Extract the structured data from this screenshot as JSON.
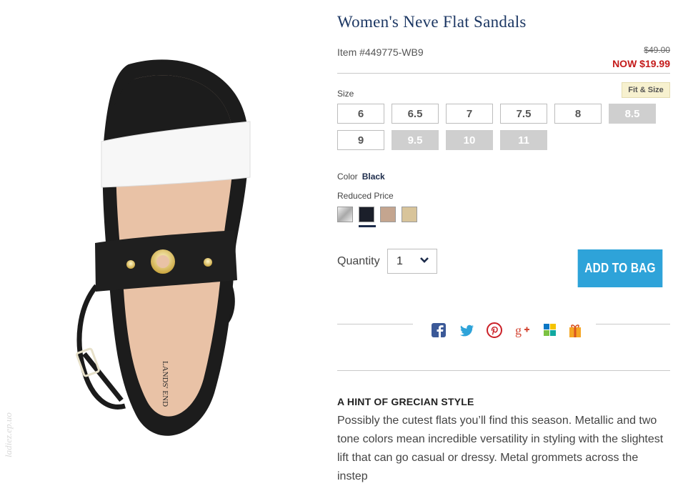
{
  "product": {
    "title": "Women's Neve Flat Sandals",
    "item_number": "Item #449775-WB9",
    "original_price": "$49.00",
    "sale_price": "NOW $19.99",
    "brand_on_insole": "LANDS' END"
  },
  "size": {
    "label": "Size",
    "fit_button": "Fit & Size",
    "options": [
      {
        "label": "6",
        "available": true
      },
      {
        "label": "6.5",
        "available": true
      },
      {
        "label": "7",
        "available": true
      },
      {
        "label": "7.5",
        "available": true
      },
      {
        "label": "8",
        "available": true
      },
      {
        "label": "8.5",
        "available": false
      },
      {
        "label": "9",
        "available": true
      },
      {
        "label": "9.5",
        "available": false
      },
      {
        "label": "10",
        "available": false
      },
      {
        "label": "11",
        "available": false
      }
    ]
  },
  "color": {
    "label": "Color",
    "selected": "Black",
    "group_label": "Reduced Price",
    "swatches": [
      {
        "name": "metallic-silver",
        "color": "#cfcfcf"
      },
      {
        "name": "black",
        "color": "#1b1f2a",
        "selected": true
      },
      {
        "name": "tan",
        "color": "#c4a58f"
      },
      {
        "name": "gold",
        "color": "#d8c49a"
      }
    ]
  },
  "quantity": {
    "label": "Quantity",
    "value": "1"
  },
  "add_to_bag": "ADD TO BAG",
  "share_icons": [
    "facebook-icon",
    "twitter-icon",
    "pinterest-icon",
    "google-plus-icon",
    "brand-share-icon",
    "gift-icon"
  ],
  "description": {
    "heading": "A HINT OF GRECIAN STYLE",
    "body": "Possibly the cutest flats you’ll find this season. Metallic and two tone colors mean incredible versatility in styling with the slightest lift that can go casual or dressy. Metal grommets across the instep"
  },
  "watermark": "ladiez.ep.uo",
  "colors": {
    "title": "#1c3763",
    "sale": "#c41a1a",
    "accent": "#2ea3d9",
    "unavailable": "#cfcfcf"
  }
}
